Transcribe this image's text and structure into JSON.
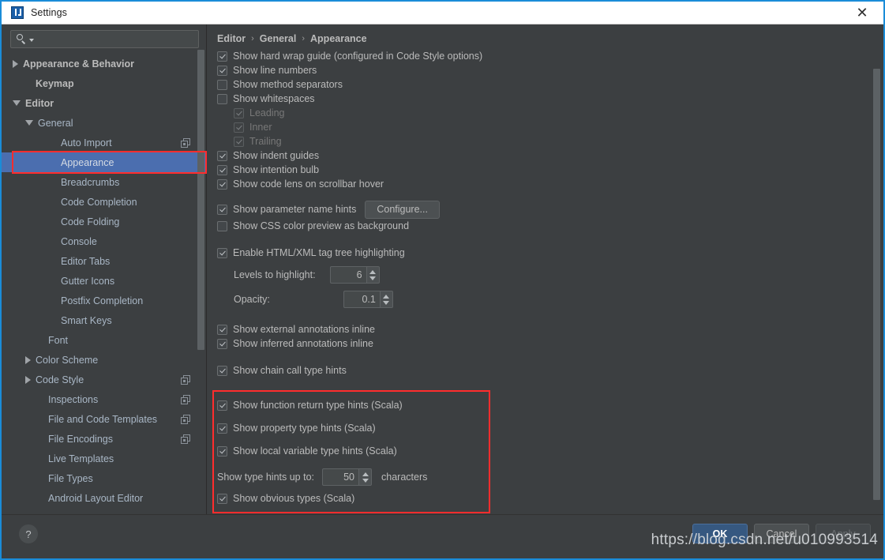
{
  "window": {
    "title": "Settings",
    "close_label": "✕",
    "app_icon": "intellij-idea-icon"
  },
  "search": {
    "value": "",
    "placeholder": ""
  },
  "sidebar": {
    "items": [
      {
        "label": "Appearance & Behavior",
        "indent": 0,
        "arrow": "closed",
        "bold": true,
        "selected": false,
        "copy": false
      },
      {
        "label": "Keymap",
        "indent": 1,
        "arrow": "none",
        "bold": true,
        "selected": false,
        "copy": false
      },
      {
        "label": "Editor",
        "indent": 0,
        "arrow": "open",
        "bold": true,
        "selected": false,
        "copy": false
      },
      {
        "label": "General",
        "indent": 1,
        "arrow": "open",
        "bold": false,
        "selected": false,
        "copy": false
      },
      {
        "label": "Auto Import",
        "indent": 3,
        "arrow": "none",
        "bold": false,
        "selected": false,
        "copy": true
      },
      {
        "label": "Appearance",
        "indent": 3,
        "arrow": "none",
        "bold": false,
        "selected": true,
        "copy": false
      },
      {
        "label": "Breadcrumbs",
        "indent": 3,
        "arrow": "none",
        "bold": false,
        "selected": false,
        "copy": false
      },
      {
        "label": "Code Completion",
        "indent": 3,
        "arrow": "none",
        "bold": false,
        "selected": false,
        "copy": false
      },
      {
        "label": "Code Folding",
        "indent": 3,
        "arrow": "none",
        "bold": false,
        "selected": false,
        "copy": false
      },
      {
        "label": "Console",
        "indent": 3,
        "arrow": "none",
        "bold": false,
        "selected": false,
        "copy": false
      },
      {
        "label": "Editor Tabs",
        "indent": 3,
        "arrow": "none",
        "bold": false,
        "selected": false,
        "copy": false
      },
      {
        "label": "Gutter Icons",
        "indent": 3,
        "arrow": "none",
        "bold": false,
        "selected": false,
        "copy": false
      },
      {
        "label": "Postfix Completion",
        "indent": 3,
        "arrow": "none",
        "bold": false,
        "selected": false,
        "copy": false
      },
      {
        "label": "Smart Keys",
        "indent": 3,
        "arrow": "none",
        "bold": false,
        "selected": false,
        "copy": false
      },
      {
        "label": "Font",
        "indent": 2,
        "arrow": "none",
        "bold": false,
        "selected": false,
        "copy": false
      },
      {
        "label": "Color Scheme",
        "indent": 1,
        "arrow": "closed",
        "bold": false,
        "selected": false,
        "copy": false
      },
      {
        "label": "Code Style",
        "indent": 1,
        "arrow": "closed",
        "bold": false,
        "selected": false,
        "copy": true
      },
      {
        "label": "Inspections",
        "indent": 2,
        "arrow": "none",
        "bold": false,
        "selected": false,
        "copy": true
      },
      {
        "label": "File and Code Templates",
        "indent": 2,
        "arrow": "none",
        "bold": false,
        "selected": false,
        "copy": true
      },
      {
        "label": "File Encodings",
        "indent": 2,
        "arrow": "none",
        "bold": false,
        "selected": false,
        "copy": true
      },
      {
        "label": "Live Templates",
        "indent": 2,
        "arrow": "none",
        "bold": false,
        "selected": false,
        "copy": false
      },
      {
        "label": "File Types",
        "indent": 2,
        "arrow": "none",
        "bold": false,
        "selected": false,
        "copy": false
      },
      {
        "label": "Android Layout Editor",
        "indent": 2,
        "arrow": "none",
        "bold": false,
        "selected": false,
        "copy": false
      }
    ]
  },
  "breadcrumb": {
    "parts": [
      "Editor",
      "General",
      "Appearance"
    ],
    "separator": "›"
  },
  "options": {
    "hard_wrap_guide": {
      "label": "Show hard wrap guide (configured in Code Style options)",
      "checked": true
    },
    "line_numbers": {
      "label": "Show line numbers",
      "checked": true
    },
    "method_separators": {
      "label": "Show method separators",
      "checked": false
    },
    "whitespaces": {
      "label": "Show whitespaces",
      "checked": false
    },
    "leading": {
      "label": "Leading",
      "checked": true
    },
    "inner": {
      "label": "Inner",
      "checked": true
    },
    "trailing": {
      "label": "Trailing",
      "checked": true
    },
    "indent_guides": {
      "label": "Show indent guides",
      "checked": true
    },
    "intention_bulb": {
      "label": "Show intention bulb",
      "checked": true
    },
    "code_lens": {
      "label": "Show code lens on scrollbar hover",
      "checked": true
    },
    "param_name_hints": {
      "label": "Show parameter name hints",
      "checked": true
    },
    "configure_button": "Configure...",
    "css_color_preview": {
      "label": "Show CSS color preview as background",
      "checked": false
    },
    "tag_tree_highlighting": {
      "label": "Enable HTML/XML tag tree highlighting",
      "checked": true
    },
    "levels_to_highlight": {
      "label": "Levels to highlight:",
      "value": "6"
    },
    "opacity": {
      "label": "Opacity:",
      "value": "0.1"
    },
    "external_annotations": {
      "label": "Show external annotations inline",
      "checked": true
    },
    "inferred_annotations": {
      "label": "Show inferred annotations inline",
      "checked": true
    },
    "chain_call_hints": {
      "label": "Show chain call type hints",
      "checked": true
    }
  },
  "scala_group": {
    "function_return_hints": {
      "label": "Show function return type hints (Scala)",
      "checked": true
    },
    "property_hints": {
      "label": "Show property type hints (Scala)",
      "checked": true
    },
    "local_variable_hints": {
      "label": "Show local variable type hints (Scala)",
      "checked": true
    },
    "type_hints_up_to": {
      "label": "Show type hints up to:",
      "value": "50",
      "unit": "characters"
    },
    "obvious_types": {
      "label": "Show obvious types (Scala)",
      "checked": true
    },
    "highlight_color": "#ff2d2d"
  },
  "footer": {
    "help_label": "?",
    "ok": "OK",
    "cancel": "Cancel",
    "apply": "Apply"
  },
  "watermark": "https://blog.csdn.net/u010993514",
  "colors": {
    "selection_blue": "#4b6eaf",
    "ok_blue": "#365880",
    "highlight_red": "#ff2d2d",
    "panel_bg": "#3c3f41",
    "text": "#bbbbbb"
  }
}
